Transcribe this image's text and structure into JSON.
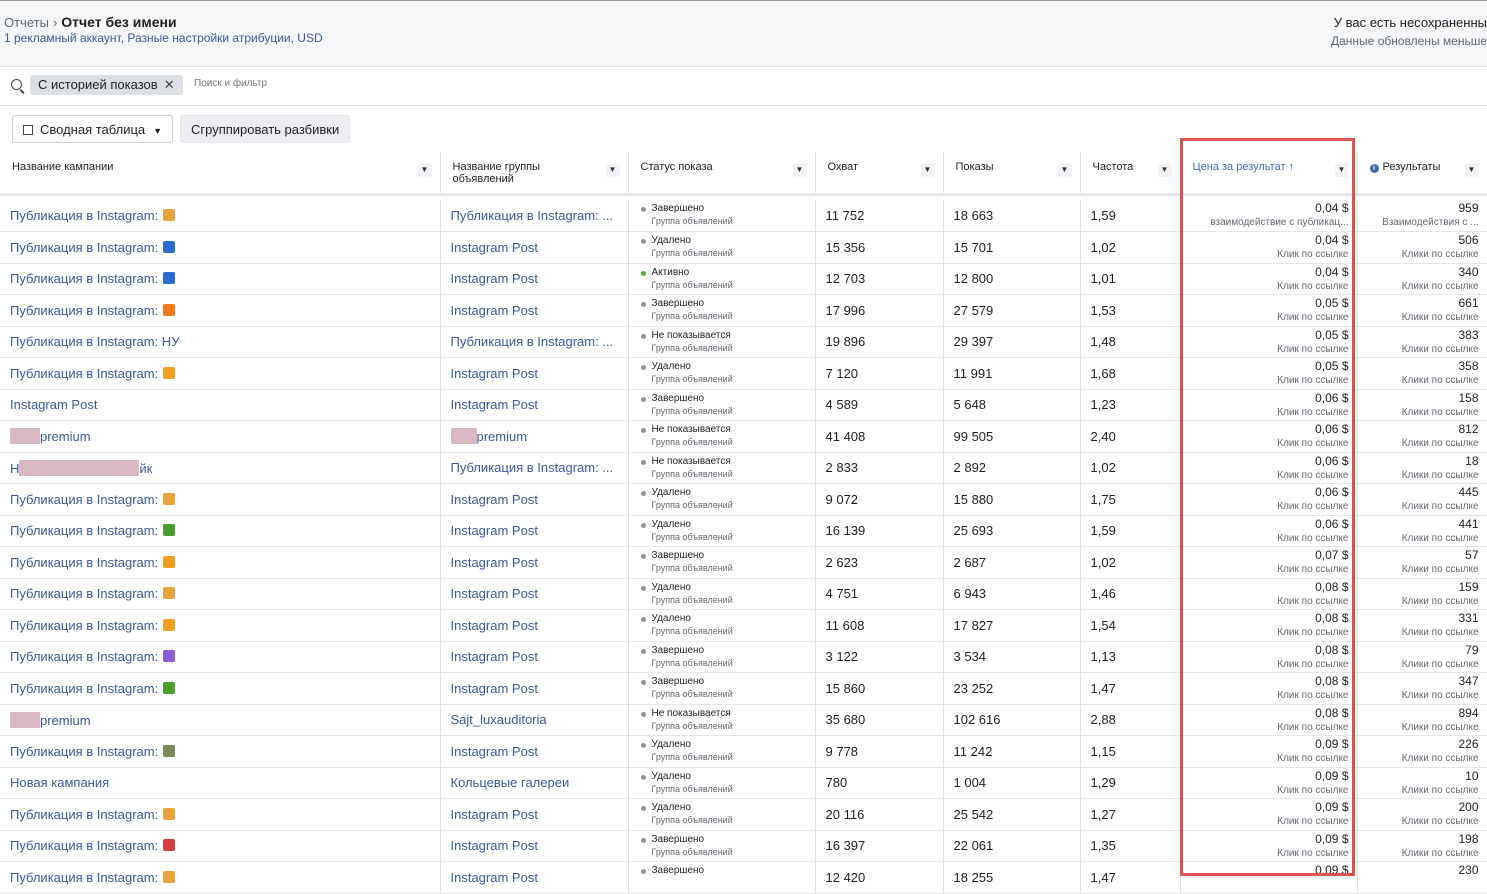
{
  "header": {
    "breadcrumb_root": "Отчеты",
    "title": "Отчет без имени",
    "subtitle": "1 рекламный аккаунт, Разные настройки атрибуции, USD",
    "unsaved": "У вас есть несохраненны",
    "updated": "Данные обновлены меньше"
  },
  "filter": {
    "chip": "С историей показов",
    "placeholder": "Поиск и фильтр"
  },
  "toolbar": {
    "pivot_label": "Сводная таблица",
    "group_label": "Сгруппировать разбивки"
  },
  "columns": {
    "campaign": "Название кампании",
    "adset": "Название группы объявлений",
    "status": "Статус показа",
    "reach": "Охват",
    "impressions": "Показы",
    "frequency": "Частота",
    "cost": "Цена за результат ↑",
    "results": "Результаты"
  },
  "highlight_color": "#d9534f",
  "rows": [
    {
      "campaign": "Публикация в Instagram:",
      "emoji": "#e8a33d",
      "adset": "Публикация в Instagram: ...",
      "status": "Завершено",
      "status_sub": "Группа объявлений",
      "reach": "11 752",
      "impr": "18 663",
      "freq": "1,59",
      "cost": "0,04 $",
      "cost_label": "взаимодействие с публикац...",
      "results": "959",
      "results_label": "Взаимодействия с ..."
    },
    {
      "campaign": "Публикация в Instagram:",
      "emoji": "#2a6bd1",
      "adset": "Instagram Post",
      "status": "Удалено",
      "status_sub": "Группа объявлений",
      "reach": "15 356",
      "impr": "15 701",
      "freq": "1,02",
      "cost": "0,04 $",
      "cost_label": "Клик по ссылке",
      "results": "506",
      "results_label": "Клики по ссылке"
    },
    {
      "campaign": "Публикация в Instagram:",
      "emoji": "#2a6bd1",
      "adset": "Instagram Post",
      "status": "Активно",
      "status_sub": "Группа объявлений",
      "reach": "12 703",
      "impr": "12 800",
      "freq": "1,01",
      "cost": "0,04 $",
      "cost_label": "Клик по ссылке",
      "results": "340",
      "results_label": "Клики по ссылке",
      "active": true
    },
    {
      "campaign": "Публикация в Instagram:",
      "emoji": "#f07b1e",
      "adset": "Instagram Post",
      "status": "Завершено",
      "status_sub": "Группа объявлений",
      "reach": "17 996",
      "impr": "27 579",
      "freq": "1,53",
      "cost": "0,05 $",
      "cost_label": "Клик по ссылке",
      "results": "661",
      "results_label": "Клики по ссылке"
    },
    {
      "campaign": "Публикация в Instagram: НУ",
      "emoji": "",
      "adset": "Публикация в Instagram: ...",
      "status": "Не показывается",
      "status_sub": "Группа объявлений",
      "reach": "19 896",
      "impr": "29 397",
      "freq": "1,48",
      "cost": "0,05 $",
      "cost_label": "Клик по ссылке",
      "results": "383",
      "results_label": "Клики по ссылке"
    },
    {
      "campaign": "Публикация в Instagram:",
      "emoji": "#f0a020",
      "adset": "Instagram Post",
      "status": "Удалено",
      "status_sub": "Группа объявлений",
      "reach": "7 120",
      "impr": "11 991",
      "freq": "1,68",
      "cost": "0,05 $",
      "cost_label": "Клик по ссылке",
      "results": "358",
      "results_label": "Клики по ссылке"
    },
    {
      "campaign": "Instagram Post",
      "emoji": "",
      "adset": "Instagram Post",
      "status": "Завершено",
      "status_sub": "Группа объявлений",
      "reach": "4 589",
      "impr": "5 648",
      "freq": "1,23",
      "cost": "0,06 $",
      "cost_label": "Клик по ссылке",
      "results": "158",
      "results_label": "Клики по ссылке"
    },
    {
      "campaign": "premium",
      "emoji": "",
      "redact_campaign": 30,
      "redact_adset": 26,
      "adset": "premium",
      "status": "Не показывается",
      "status_sub": "Группа объявлений",
      "reach": "41 408",
      "impr": "99 505",
      "freq": "2,40",
      "cost": "0,06 $",
      "cost_label": "Клик по ссылке",
      "results": "812",
      "results_label": "Клики по ссылке"
    },
    {
      "campaign": "Н",
      "campaign_tail": "йк",
      "emoji": "",
      "redact_campaign_mid": 120,
      "adset": "Публикация в Instagram: ...",
      "status": "Не показывается",
      "status_sub": "Группа объявлений",
      "reach": "2 833",
      "impr": "2 892",
      "freq": "1,02",
      "cost": "0,06 $",
      "cost_label": "Клик по ссылке",
      "results": "18",
      "results_label": "Клики по ссылке"
    },
    {
      "campaign": "Публикация в Instagram:",
      "emoji": "#e8a33d",
      "adset": "Instagram Post",
      "status": "Удалено",
      "status_sub": "Группа объявлений",
      "reach": "9 072",
      "impr": "15 880",
      "freq": "1,75",
      "cost": "0,06 $",
      "cost_label": "Клик по ссылке",
      "results": "445",
      "results_label": "Клики по ссылке"
    },
    {
      "campaign": "Публикация в Instagram:",
      "emoji": "#4a9e2f",
      "adset": "Instagram Post",
      "status": "Удалено",
      "status_sub": "Группа объявлений",
      "reach": "16 139",
      "impr": "25 693",
      "freq": "1,59",
      "cost": "0,06 $",
      "cost_label": "Клик по ссылке",
      "results": "441",
      "results_label": "Клики по ссылке"
    },
    {
      "campaign": "Публикация в Instagram:",
      "emoji": "#f0a020",
      "adset": "Instagram Post",
      "status": "Завершено",
      "status_sub": "Группа объявлений",
      "reach": "2 623",
      "impr": "2 687",
      "freq": "1,02",
      "cost": "0,07 $",
      "cost_label": "Клик по ссылке",
      "results": "57",
      "results_label": "Клики по ссылке"
    },
    {
      "campaign": "Публикация в Instagram:",
      "emoji": "#e8a33d",
      "adset": "Instagram Post",
      "status": "Удалено",
      "status_sub": "Группа объявлений",
      "reach": "4 751",
      "impr": "6 943",
      "freq": "1,46",
      "cost": "0,08 $",
      "cost_label": "Клик по ссылке",
      "results": "159",
      "results_label": "Клики по ссылке"
    },
    {
      "campaign": "Публикация в Instagram:",
      "emoji": "#f0a020",
      "adset": "Instagram Post",
      "status": "Удалено",
      "status_sub": "Группа объявлений",
      "reach": "11 608",
      "impr": "17 827",
      "freq": "1,54",
      "cost": "0,08 $",
      "cost_label": "Клик по ссылке",
      "results": "331",
      "results_label": "Клики по ссылке"
    },
    {
      "campaign": "Публикация в Instagram:",
      "emoji": "#8a5ad8",
      "adset": "Instagram Post",
      "status": "Завершено",
      "status_sub": "Группа объявлений",
      "reach": "3 122",
      "impr": "3 534",
      "freq": "1,13",
      "cost": "0,08 $",
      "cost_label": "Клик по ссылке",
      "results": "79",
      "results_label": "Клики по ссылке"
    },
    {
      "campaign": "Публикация в Instagram:",
      "emoji": "#4a9e2f",
      "adset": "Instagram Post",
      "status": "Завершено",
      "status_sub": "Группа объявлений",
      "reach": "15 860",
      "impr": "23 252",
      "freq": "1,47",
      "cost": "0,08 $",
      "cost_label": "Клик по ссылке",
      "results": "347",
      "results_label": "Клики по ссылке"
    },
    {
      "campaign": "premium",
      "emoji": "",
      "redact_campaign": 30,
      "adset": "Sajt_luxauditoria",
      "status": "Не показывается",
      "status_sub": "Группа объявлений",
      "reach": "35 680",
      "impr": "102 616",
      "freq": "2,88",
      "cost": "0,08 $",
      "cost_label": "Клик по ссылке",
      "results": "894",
      "results_label": "Клики по ссылке"
    },
    {
      "campaign": "Публикация в Instagram:",
      "emoji": "#7a8a5a",
      "adset": "Instagram Post",
      "status": "Удалено",
      "status_sub": "Группа объявлений",
      "reach": "9 778",
      "impr": "11 242",
      "freq": "1,15",
      "cost": "0,09 $",
      "cost_label": "Клик по ссылке",
      "results": "226",
      "results_label": "Клики по ссылке"
    },
    {
      "campaign": "Новая кампания",
      "emoji": "",
      "adset": "Кольцевые галереи",
      "status": "Удалено",
      "status_sub": "Группа объявлений",
      "reach": "780",
      "impr": "1 004",
      "freq": "1,29",
      "cost": "0,09 $",
      "cost_label": "Клик по ссылке",
      "results": "10",
      "results_label": "Клики по ссылке"
    },
    {
      "campaign": "Публикация в Instagram:",
      "emoji": "#e8a33d",
      "adset": "Instagram Post",
      "status": "Удалено",
      "status_sub": "Группа объявлений",
      "reach": "20 116",
      "impr": "25 542",
      "freq": "1,27",
      "cost": "0,09 $",
      "cost_label": "Клик по ссылке",
      "results": "200",
      "results_label": "Клики по ссылке"
    },
    {
      "campaign": "Публикация в Instagram:",
      "emoji": "#d04040",
      "adset": "Instagram Post",
      "status": "Завершено",
      "status_sub": "Группа объявлений",
      "reach": "16 397",
      "impr": "22 061",
      "freq": "1,35",
      "cost": "0,09 $",
      "cost_label": "Клик по ссылке",
      "results": "198",
      "results_label": "Клики по ссылке"
    },
    {
      "campaign": "Публикация в Instagram:",
      "emoji": "#e8a33d",
      "adset": "Instagram Post",
      "status": "Завершено",
      "status_sub": "",
      "reach": "12 420",
      "impr": "18 255",
      "freq": "1,47",
      "cost": "0,09 $",
      "cost_label": "",
      "results": "230",
      "results_label": ""
    }
  ]
}
